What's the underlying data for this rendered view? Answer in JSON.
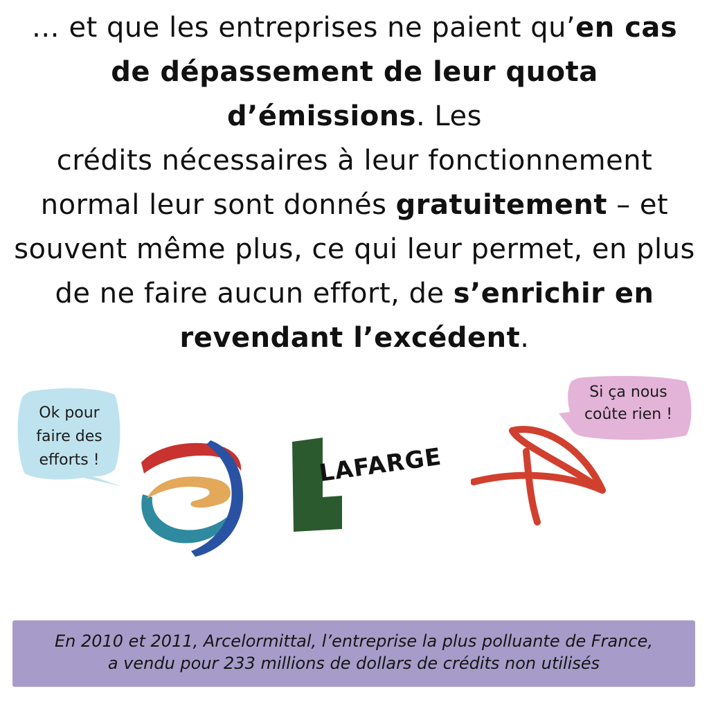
{
  "narration": {
    "line1_a": "… et que les entreprises ne paient qu’",
    "line1_b": "en cas",
    "line2_a": "de dépassement de leur quota d’émissions",
    "line2_b": ". Les",
    "line3": "crédits nécessaires à leur fonctionnement",
    "line4_a": "normal leur sont donnés ",
    "line4_b": "gratuitement",
    "line4_c": " – et",
    "line5": "souvent même plus, ce qui leur permet, en plus",
    "line6_a": "de ne faire aucun effort, de ",
    "line6_b": "s’enrichir en",
    "line7_a": "revendant l’excédent",
    "line7_b": "."
  },
  "bubble_left": {
    "line1": "Ok pour",
    "line2": "faire des",
    "line3": "efforts !",
    "color": "#bfe3ee"
  },
  "bubble_right": {
    "line1": "Si ça nous",
    "line2": "coûte rien !",
    "color": "#e4b3d8"
  },
  "logos": {
    "total": "total-logo",
    "lafarge_text": "LAFARGE",
    "arrow": "arrow-logo"
  },
  "caption": {
    "line1": "En 2010 et 2011, Arcelormittal, l’entreprise la plus polluante de France,",
    "line2": "a vendu pour 233 millions de dollars de crédits non utilisés",
    "color": "#a79cc9"
  }
}
